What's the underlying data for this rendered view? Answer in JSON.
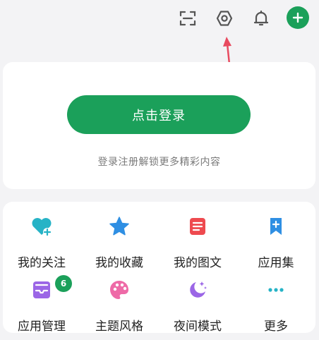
{
  "topbar": {
    "icons": [
      "scan-icon",
      "settings-icon",
      "bell-icon",
      "add-icon"
    ]
  },
  "login": {
    "button_label": "点击登录",
    "hint": "登录注册解锁更多精彩内容"
  },
  "grid": {
    "items": [
      {
        "label": "我的关注",
        "icon": "heart-plus-icon",
        "color": "#26b3c6"
      },
      {
        "label": "我的收藏",
        "icon": "star-icon",
        "color": "#2f8fe3"
      },
      {
        "label": "我的图文",
        "icon": "document-icon",
        "color": "#ee4a4f"
      },
      {
        "label": "应用集",
        "icon": "bookmark-plus-icon",
        "color": "#2f8fe3"
      },
      {
        "label": "应用管理",
        "icon": "inbox-icon",
        "color": "#9b66e6",
        "badge": "6"
      },
      {
        "label": "主题风格",
        "icon": "palette-icon",
        "color": "#ee6aa7"
      },
      {
        "label": "夜间模式",
        "icon": "moon-icon",
        "color": "#9b66e6"
      },
      {
        "label": "更多",
        "icon": "more-dots-icon",
        "color": "#26b3c6"
      }
    ]
  },
  "colors": {
    "brand_green": "#1ba05a",
    "annotation_arrow": "#e84a5f"
  }
}
